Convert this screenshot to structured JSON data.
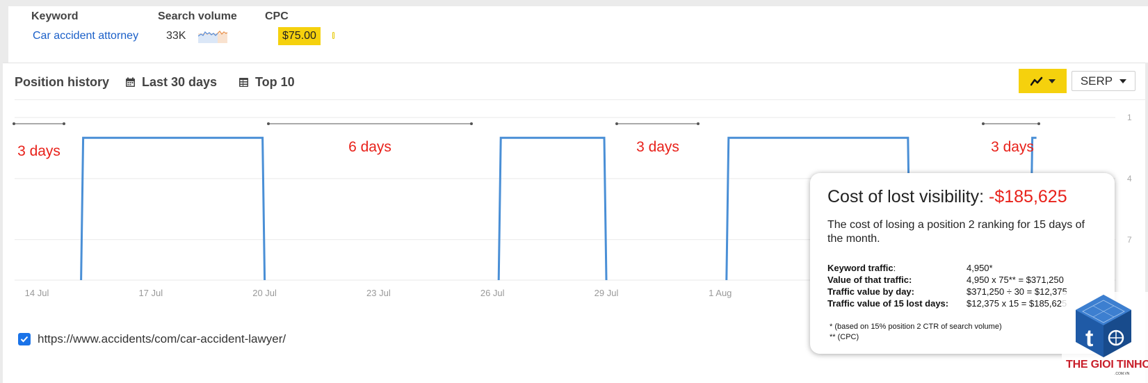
{
  "keyword_panel": {
    "keyword_header": "Keyword",
    "volume_header": "Search volume",
    "cpc_header": "CPC",
    "keyword": "Car accident attorney",
    "volume": "33K",
    "cpc": "$75.00"
  },
  "toolbar": {
    "title": "Position history",
    "date_range": "Last 30 days",
    "top_filter": "Top 10",
    "serp_label": "SERP",
    "accent_color": "#f5d10d"
  },
  "chart_data": {
    "type": "line",
    "title": "",
    "xlabel": "",
    "ylabel": "",
    "x_ticks": [
      "14 Jul",
      "17 Jul",
      "20 Jul",
      "23 Jul",
      "26 Jul",
      "29 Jul",
      "1 Aug"
    ],
    "y_ticks": [
      1,
      4,
      7
    ],
    "y_reversed": true,
    "grid": true,
    "series": [
      {
        "color": "#4a8fd6",
        "ranking_periods": [
          {
            "start": "15 Jul",
            "end": "20 Jul",
            "position": 2
          },
          {
            "start": "26 Jul",
            "end": "29 Jul",
            "position": 2
          },
          {
            "start": "1 Aug",
            "end": "6 Aug",
            "position": 2
          },
          {
            "start": "9 Aug",
            "end": "",
            "position": 2
          }
        ]
      }
    ],
    "annotations": [
      {
        "text": "3 days"
      },
      {
        "text": "6 days"
      },
      {
        "text": "3 days"
      },
      {
        "text": "3 days"
      }
    ],
    "annotation_color": "#e8211a"
  },
  "url": "https://www.accidents/com/car-accident-lawyer/",
  "popup": {
    "title": "Cost of lost visibility:",
    "title_value": "-$185,625",
    "description": "The cost of losing a position 2 ranking for 15 days of the month.",
    "rows": [
      {
        "label": "Keyword traffic",
        "value": "4,950*"
      },
      {
        "label": "Value of that traffic",
        "value": "4,950 x 75** = $371,250"
      },
      {
        "label": "Traffic value by day",
        "value": "$371,250 ÷ 30 = $12,375"
      },
      {
        "label": "Traffic value of 15 lost days",
        "value": "$12,375 x 15 = $185,625"
      }
    ],
    "note1": "* (based on 15% position 2 CTR of search volume)",
    "note2": "** (CPC)"
  },
  "watermark": {
    "text": "THE GIOI TINHOC",
    "sub": ".COM.VN"
  }
}
